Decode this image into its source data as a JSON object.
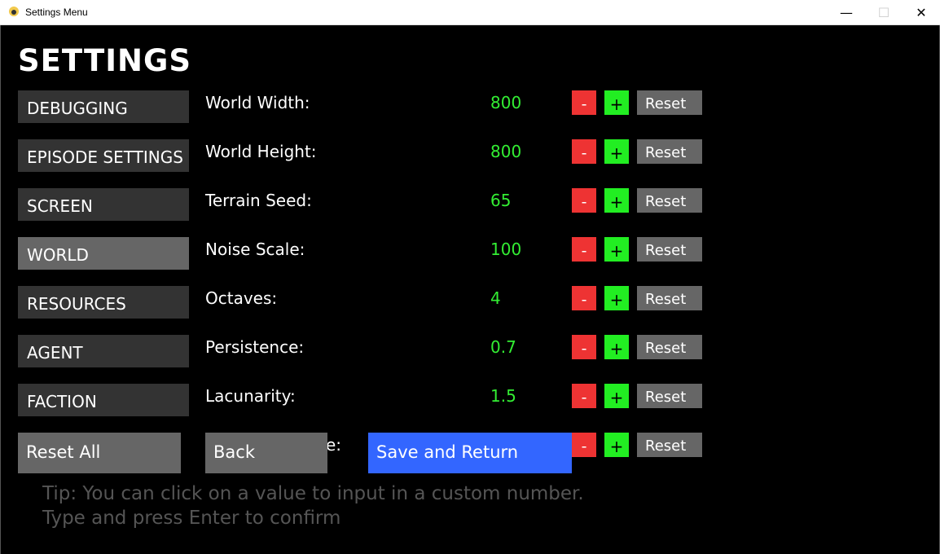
{
  "window": {
    "title": "Settings Menu",
    "minimize_glyph": "—",
    "maximize_glyph": "☐",
    "close_glyph": "✕"
  },
  "heading": "SETTINGS",
  "categories": [
    {
      "label": "DEBUGGING",
      "active": false
    },
    {
      "label": "EPISODE SETTINGS",
      "active": false
    },
    {
      "label": "SCREEN",
      "active": false
    },
    {
      "label": "WORLD",
      "active": true
    },
    {
      "label": "RESOURCES",
      "active": false
    },
    {
      "label": "AGENT",
      "active": false
    },
    {
      "label": "FACTION",
      "active": false
    }
  ],
  "settings": [
    {
      "label": "World Width:",
      "value": "800"
    },
    {
      "label": "World Height:",
      "value": "800"
    },
    {
      "label": "Terrain Seed:",
      "value": "65"
    },
    {
      "label": "Noise Scale:",
      "value": "100"
    },
    {
      "label": "Octaves:",
      "value": "4"
    },
    {
      "label": "Persistence:",
      "value": "0.7"
    },
    {
      "label": "Lacunarity:",
      "value": "1.5"
    },
    {
      "label": "e:",
      "value": ""
    }
  ],
  "controls": {
    "minus_label": "-",
    "plus_label": "+",
    "reset_label": "Reset"
  },
  "buttons": {
    "reset_all": "Reset All",
    "back": "Back",
    "save": "Save and Return"
  },
  "tip": {
    "line1": "Tip: You can click on a value to input in a custom number.",
    "line2": "Type and press Enter to confirm"
  },
  "colors": {
    "value_green": "#33ee33",
    "minus_red": "#ee3333",
    "plus_green": "#22ee22",
    "save_blue": "#3366ff"
  }
}
